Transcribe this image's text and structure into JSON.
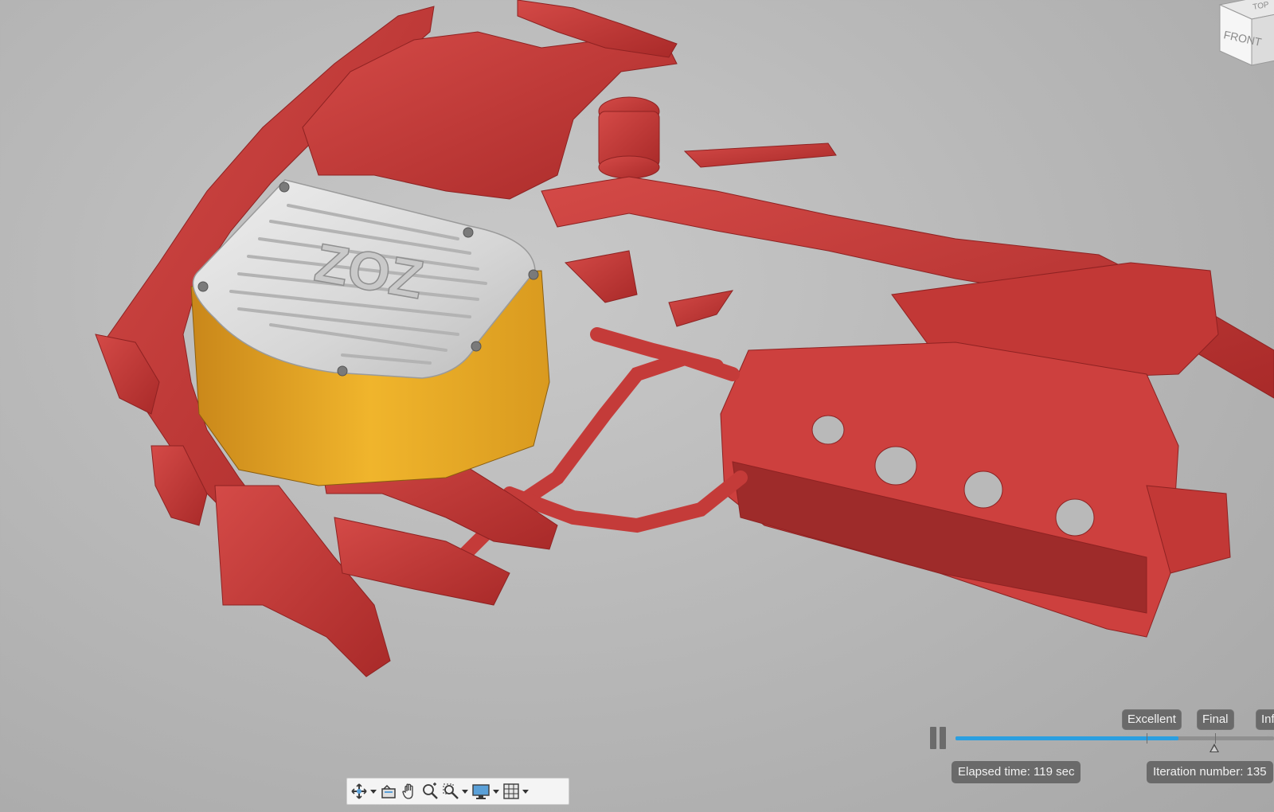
{
  "viewcube": {
    "top_label": "TOP",
    "front_label": "FRONT"
  },
  "scene": {
    "cover_text": "ZOZ",
    "colors": {
      "background": "#b9b9b9",
      "scan_mesh": "#c83c3a",
      "housing": "#e6a624",
      "cover_plate": "#d9d9d9"
    }
  },
  "render": {
    "quality_labels": {
      "excellent": "Excellent",
      "final": "Final",
      "infinite": "Infinite"
    },
    "elapsed_time": "Elapsed time: 119 sec",
    "iteration_number": "Iteration number: 135",
    "progress": 0.7,
    "progress_color": "#2a9fe0"
  },
  "toolbar": {
    "icons": [
      "orbit-icon",
      "look-at-icon",
      "pan-icon",
      "zoom-icon",
      "fit-icon",
      "display-settings-icon",
      "grid-icon"
    ]
  }
}
